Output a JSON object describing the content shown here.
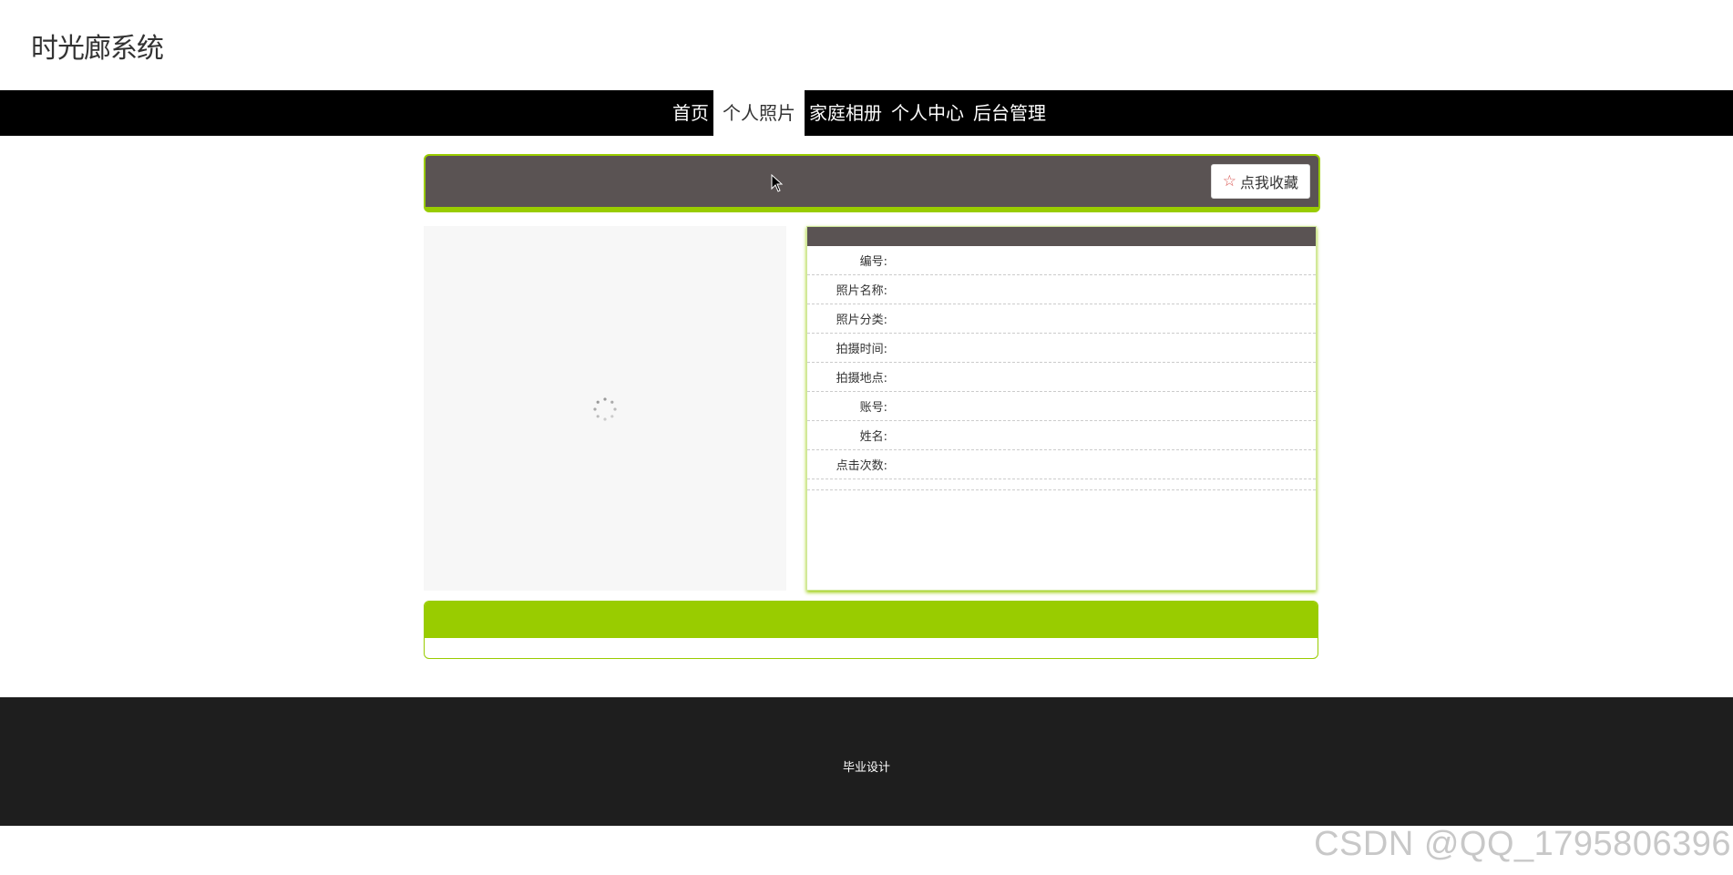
{
  "header": {
    "title": "时光廊系统"
  },
  "nav": {
    "items": [
      {
        "label": "首页",
        "active": false
      },
      {
        "label": "个人照片",
        "active": true
      },
      {
        "label": "家庭相册",
        "active": false
      },
      {
        "label": "个人中心",
        "active": false
      },
      {
        "label": "后台管理",
        "active": false
      }
    ]
  },
  "collect": {
    "icon": "star-icon",
    "label": "点我收藏"
  },
  "image_panel": {
    "state_icon": "loading-spinner-icon"
  },
  "details": {
    "rows": [
      {
        "label": "编号:",
        "value": ""
      },
      {
        "label": "照片名称:",
        "value": ""
      },
      {
        "label": "照片分类:",
        "value": ""
      },
      {
        "label": "拍摄时间:",
        "value": ""
      },
      {
        "label": "拍摄地点:",
        "value": ""
      },
      {
        "label": "账号:",
        "value": ""
      },
      {
        "label": "姓名:",
        "value": ""
      },
      {
        "label": "点击次数:",
        "value": ""
      }
    ]
  },
  "footer": {
    "text": "毕业设计"
  },
  "watermark": {
    "text": "CSDN @QQ_1795806396"
  },
  "colors": {
    "accent": "#99cc00",
    "nav_bg": "#000000",
    "bar_bg": "#5a5353",
    "footer_bg": "#1e1e1e"
  }
}
